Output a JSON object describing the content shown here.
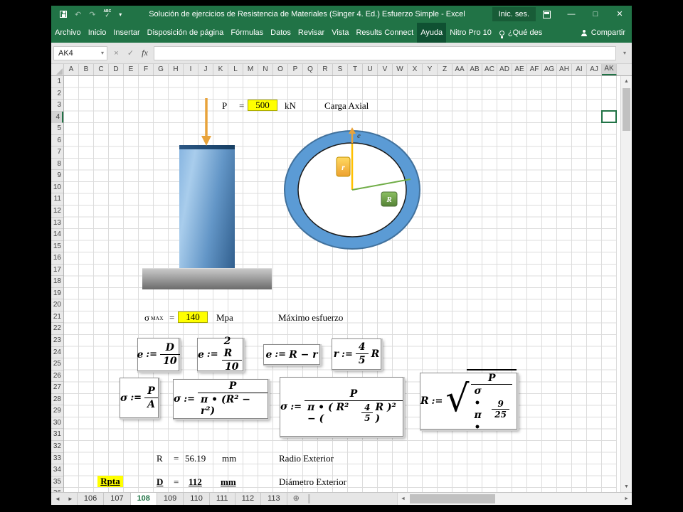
{
  "titlebar": {
    "title": "Solución de ejercicios de Resistencia de Materiales (Singer 4. Ed.) Esfuerzo Simple  -  Excel",
    "signin_label": "Inic. ses."
  },
  "icons": {
    "undo": "↶",
    "redo": "↷",
    "dropdown": "▾",
    "check": "✓",
    "cancel": "×",
    "fx": "fx",
    "minimize": "—",
    "maximize": "□",
    "close": "✕",
    "nav_left": "◄",
    "nav_right": "►",
    "add_sheet": "⊕",
    "scroll_up": "▲",
    "scroll_down": "▼",
    "scroll_left": "◄",
    "scroll_right": "►",
    "spell_abc": "ABC"
  },
  "ribbon": {
    "tabs": [
      "Archivo",
      "Inicio",
      "Insertar",
      "Disposición de página",
      "Fórmulas",
      "Datos",
      "Revisar",
      "Vista",
      "Results Connect",
      "Ayuda",
      "Nitro Pro 10"
    ],
    "active_tab": "Ayuda",
    "tellme": "¿Qué des",
    "share": "Compartir"
  },
  "formula_bar": {
    "name_box": "AK4"
  },
  "grid": {
    "columns": [
      "A",
      "B",
      "C",
      "D",
      "E",
      "F",
      "G",
      "H",
      "I",
      "J",
      "K",
      "L",
      "M",
      "N",
      "O",
      "P",
      "Q",
      "R",
      "S",
      "T",
      "U",
      "V",
      "W",
      "X",
      "Y",
      "Z",
      "AA",
      "AB",
      "AC",
      "AD",
      "AE",
      "AF",
      "AG",
      "AH",
      "AI",
      "AJ",
      "AK"
    ],
    "rows": [
      1,
      2,
      3,
      4,
      5,
      6,
      7,
      8,
      9,
      10,
      11,
      12,
      13,
      14,
      15,
      16,
      17,
      18,
      19,
      20,
      21,
      22,
      23,
      24,
      25,
      26,
      27,
      28,
      29,
      30,
      31,
      32,
      33,
      34,
      35,
      36
    ],
    "selected_column": "AK",
    "selected_row": 4
  },
  "content": {
    "row3": {
      "label": "P",
      "eq": "=",
      "value": "500",
      "unit": "kN",
      "desc": "Carga Axial"
    },
    "row21": {
      "label": "σ",
      "label_sub": "MAX",
      "eq": "=",
      "value": "140",
      "unit": "Mpa",
      "desc": "Máximo esfuerzo"
    },
    "row33": {
      "label": "R",
      "eq": "=",
      "value": "56.19",
      "unit": "mm",
      "desc": "Radio Exterior"
    },
    "row35": {
      "rpta": "Rpta",
      "label": "D",
      "eq": "=",
      "value": "112",
      "unit": "mm",
      "desc": "Diámetro Exterior"
    },
    "diagram": {
      "e_label": "e",
      "r_label": "r",
      "R_label": "R"
    }
  },
  "formulas": {
    "f1": {
      "lhs": "e",
      "op": ":=",
      "num": "D",
      "den": "10"
    },
    "f2": {
      "lhs": "e",
      "op": ":=",
      "num": "2 R",
      "den": "10"
    },
    "f3": {
      "lhs": "e",
      "op": ":=",
      "rhs": "R − r"
    },
    "f4": {
      "lhs": "r",
      "op": ":=",
      "num": "4",
      "den": "5",
      "post": "R"
    },
    "f5": {
      "lhs": "σ",
      "op": ":=",
      "num": "P",
      "den": "A"
    },
    "f6": {
      "lhs": "σ",
      "op": ":=",
      "num": "P",
      "den": "π • (R² − r²)"
    },
    "f7": {
      "lhs": "σ",
      "op": ":=",
      "num": "P",
      "den_pre": "π • ( R² − (",
      "den_fnum": "4",
      "den_fden": "5",
      "den_post": "R )² )"
    },
    "f8": {
      "lhs": "R",
      "op": ":=",
      "num": "P",
      "den_pre": "σ • π •",
      "den_fnum": "9",
      "den_fden": "25"
    }
  },
  "sheet_tabs": {
    "tabs": [
      "106",
      "107",
      "108",
      "109",
      "110",
      "111",
      "112",
      "113"
    ],
    "active": "108"
  }
}
